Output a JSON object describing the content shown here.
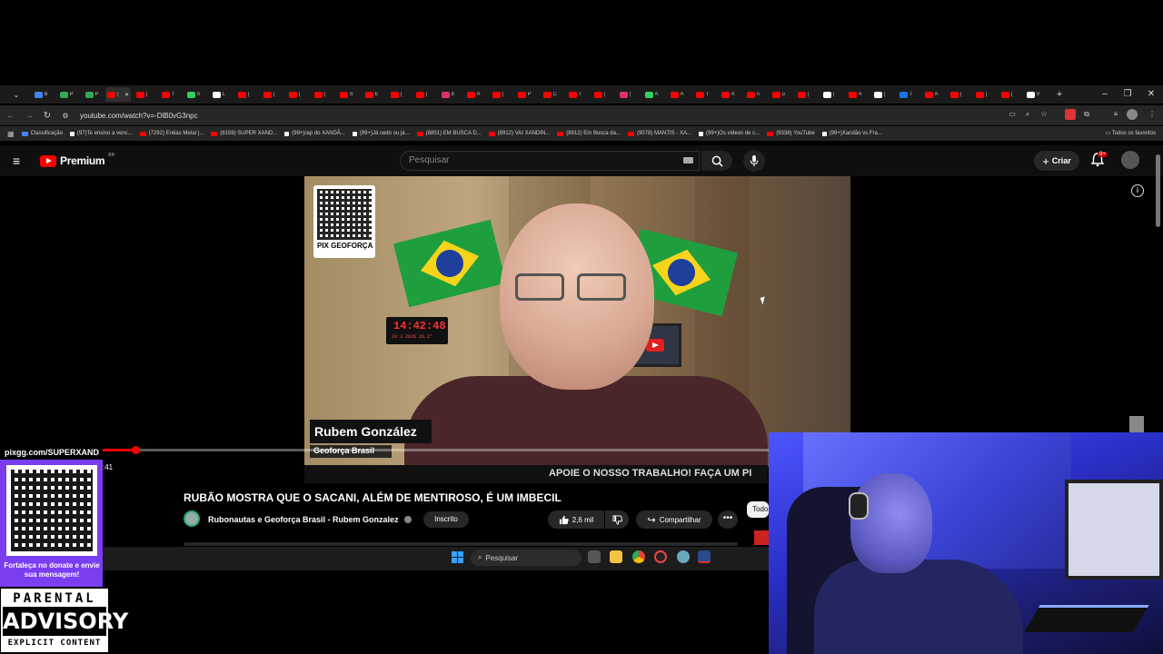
{
  "browser": {
    "tabs": [
      {
        "color": "#4285f4",
        "label": "B"
      },
      {
        "color": "#34a853",
        "label": "P"
      },
      {
        "color": "#34a853",
        "label": "P"
      },
      {
        "color": "#ff0000",
        "label": "(",
        "active": true
      },
      {
        "color": "#ff0000",
        "label": "("
      },
      {
        "color": "#ff0000",
        "label": "T"
      },
      {
        "color": "#2fd35c",
        "label": "S"
      },
      {
        "color": "#ffffff",
        "label": "L"
      },
      {
        "color": "#ff0000",
        "label": "("
      },
      {
        "color": "#ff0000",
        "label": "("
      },
      {
        "color": "#ff0000",
        "label": "("
      },
      {
        "color": "#ff0000",
        "label": "("
      },
      {
        "color": "#ff0000",
        "label": "S"
      },
      {
        "color": "#ff0000",
        "label": "E"
      },
      {
        "color": "#ff0000",
        "label": "("
      },
      {
        "color": "#ff0000",
        "label": "("
      },
      {
        "color": "#e1306c",
        "label": "b"
      },
      {
        "color": "#ff0000",
        "label": "A"
      },
      {
        "color": "#ff0000",
        "label": "("
      },
      {
        "color": "#ff0000",
        "label": "P"
      },
      {
        "color": "#ff0000",
        "label": "C"
      },
      {
        "color": "#ff0000",
        "label": "T"
      },
      {
        "color": "#ff0000",
        "label": "("
      },
      {
        "color": "#e1306c",
        "label": "("
      },
      {
        "color": "#2fd35c",
        "label": "A"
      },
      {
        "color": "#ff0000",
        "label": "A"
      },
      {
        "color": "#ff0000",
        "label": "T"
      },
      {
        "color": "#ff0000",
        "label": "A"
      },
      {
        "color": "#ff0000",
        "label": "n"
      },
      {
        "color": "#ff0000",
        "label": "u"
      },
      {
        "color": "#ff0000",
        "label": "("
      },
      {
        "color": "#ffffff",
        "label": "("
      },
      {
        "color": "#ff0000",
        "label": "A"
      },
      {
        "color": "#ffffff",
        "label": "("
      },
      {
        "color": "#1a73e8",
        "label": "T"
      },
      {
        "color": "#ff0000",
        "label": "A"
      },
      {
        "color": "#ff0000",
        "label": "("
      },
      {
        "color": "#ff0000",
        "label": "("
      },
      {
        "color": "#ff0000",
        "label": "("
      },
      {
        "color": "#ffffff",
        "label": "V"
      }
    ],
    "new_tab": "+",
    "window_controls": {
      "minimize": "–",
      "restore": "❐",
      "close": "✕"
    },
    "url": "youtube.com/watch?v=-DlB0vG3npc",
    "bookmarks": [
      "Classificação",
      "(97)Te ensino a venc...",
      "(7292) Enêas Metal |...",
      "(8159) SUPER XAND...",
      "(99+)rap do XANDÃ...",
      "(99+)Já cedo ou já...",
      "(8851) EM BUSCA D...",
      "(8912) VAI XANDIN...",
      "(8912) Em Busca da...",
      "(9078) MANTIS - XA...",
      "(99+)Os vídeos de c...",
      "(9338) YouTube",
      "(99+)Xandão vs Fra..."
    ],
    "bookmarks_all": "Todos os favoritos"
  },
  "youtube": {
    "logo_text": "Premium",
    "country_code": "BR",
    "search_placeholder": "Pesquisar",
    "create_label": "Criar",
    "notifications_badge": "9+",
    "video": {
      "qr_label": "PIX GEOFORÇA",
      "clock_time": "14:42:48",
      "clock_date": "20 3 2026  26.2°",
      "presenter_name": "Rubem González",
      "presenter_sub": "Geoforça Brasil",
      "ticker": "APOIE O NOSSO TRABALHO! FAÇA UM PI",
      "progress_fraction": 0.05,
      "timestamp": ":41"
    },
    "title": "RUBÃO MOSTRA QUE O SACANI, ALÉM DE MENTIROSO, É UM IMBECIL",
    "channel_name": "Rubonautas e Geoforça Brasil - Rubem Gonzalez",
    "subscribed_label": "Inscrito",
    "likes": "2,6 mil",
    "share_label": "Compartilhar",
    "more_label": "•••",
    "chip_label": "Todos"
  },
  "taskbar": {
    "search_placeholder": "Pesquisar"
  },
  "overlay": {
    "pix_banner": "pixgg.com/SUPERXAND",
    "pix_message": "Fortaleça no donate e envie sua mensagem!",
    "advisory_top": "PARENTAL",
    "advisory_mid": "ADVISORY",
    "advisory_bottom": "EXPLICIT CONTENT"
  },
  "colors": {
    "youtube_red": "#ff0000",
    "page_bg": "#0f0f0f",
    "pix_purple": "#7a3df0"
  }
}
